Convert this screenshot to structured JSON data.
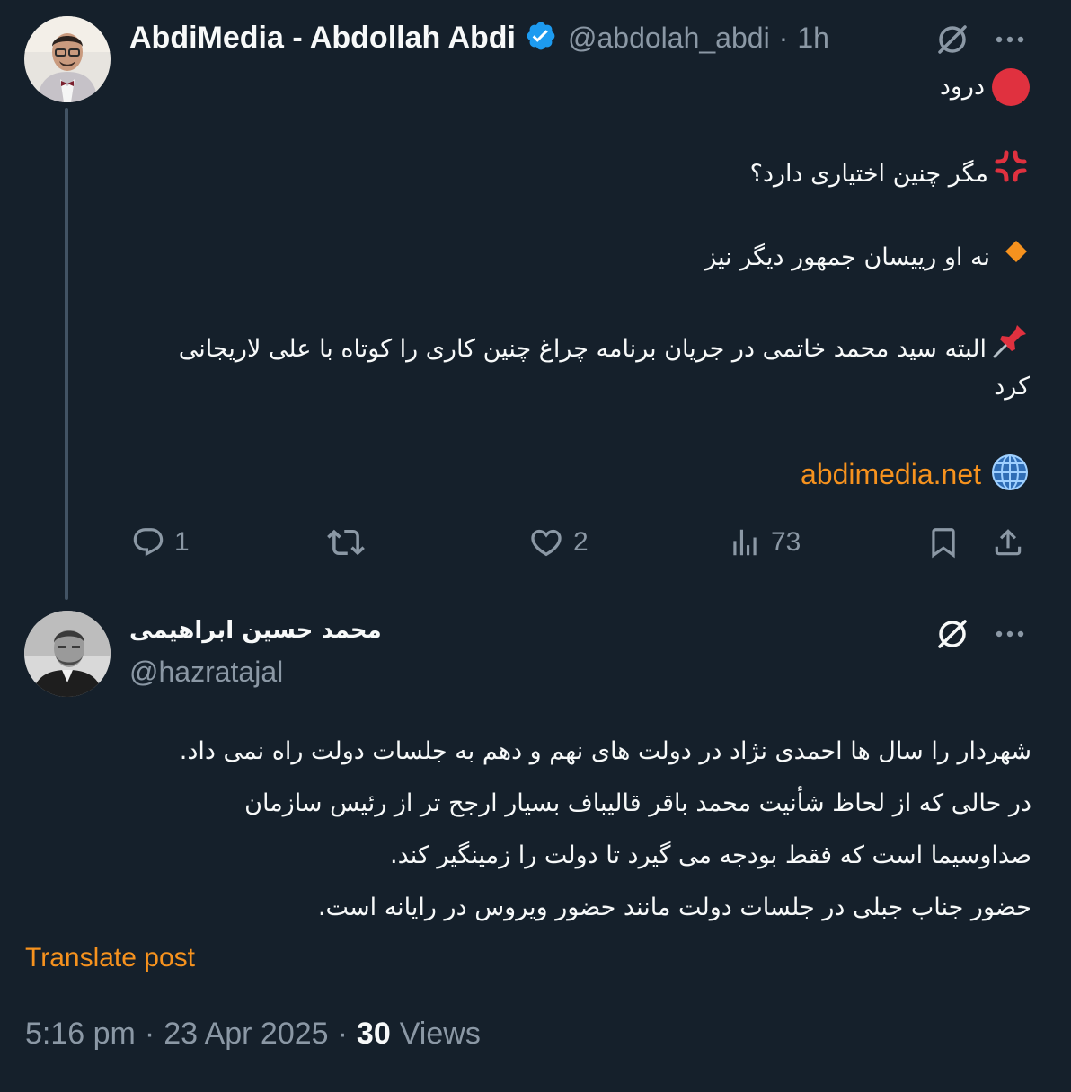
{
  "tweet1": {
    "author_name": "AbdiMedia - Abdollah Abdi",
    "handle": "@abdolah_abdi",
    "separator": "·",
    "time_ago": "1h",
    "line1_text": "درود",
    "line2_text": "مگر چنین اختیاری دارد؟",
    "line3_text": "نه او رییسان جمهور دیگر نیز",
    "line4_text_a": "البته سید محمد خاتمی در جریان برنامه چراغ چنین کاری را کوتاه با علی لاریجانی",
    "line4_text_b": "کرد",
    "link_text": "abdimedia.net",
    "replies_count": "1",
    "likes_count": "2",
    "views_count": "73",
    "icons": [
      "red-circle-emoji",
      "anger-emoji",
      "orange-diamond-emoji",
      "pushpin-emoji",
      "globe-emoji",
      "verified-badge-icon",
      "grok-icon",
      "more-icon",
      "reply-icon",
      "retweet-icon",
      "like-icon",
      "views-icon",
      "bookmark-icon",
      "share-icon"
    ]
  },
  "tweet2": {
    "author_name": "محمد حسین ابراهیمی",
    "handle": "@hazratajal",
    "body_lines": [
      "شهردار را سال ها احمدی نژاد در دولت های نهم و دهم به جلسات دولت راه نمی داد.",
      "در حالی که از لحاظ شأنیت محمد باقر قالیباف بسیار ارجح تر از رئیس سازمان",
      "صداوسیما است که فقط بودجه می گیرد تا دولت را زمینگیر کند.",
      "حضور جناب جبلی در جلسات دولت مانند حضور ویروس در رایانه است."
    ],
    "translate_label": "Translate post",
    "time": "5:16 pm",
    "separator": "·",
    "date": "23 Apr 2025",
    "views_count": "30",
    "views_label": "Views"
  },
  "colors": {
    "background": "#15202b",
    "text": "#f7f9f9",
    "muted": "#8b98a5",
    "accent_orange": "#f6921e",
    "verified_blue": "#1d9bf0",
    "thread_line": "#425364"
  }
}
